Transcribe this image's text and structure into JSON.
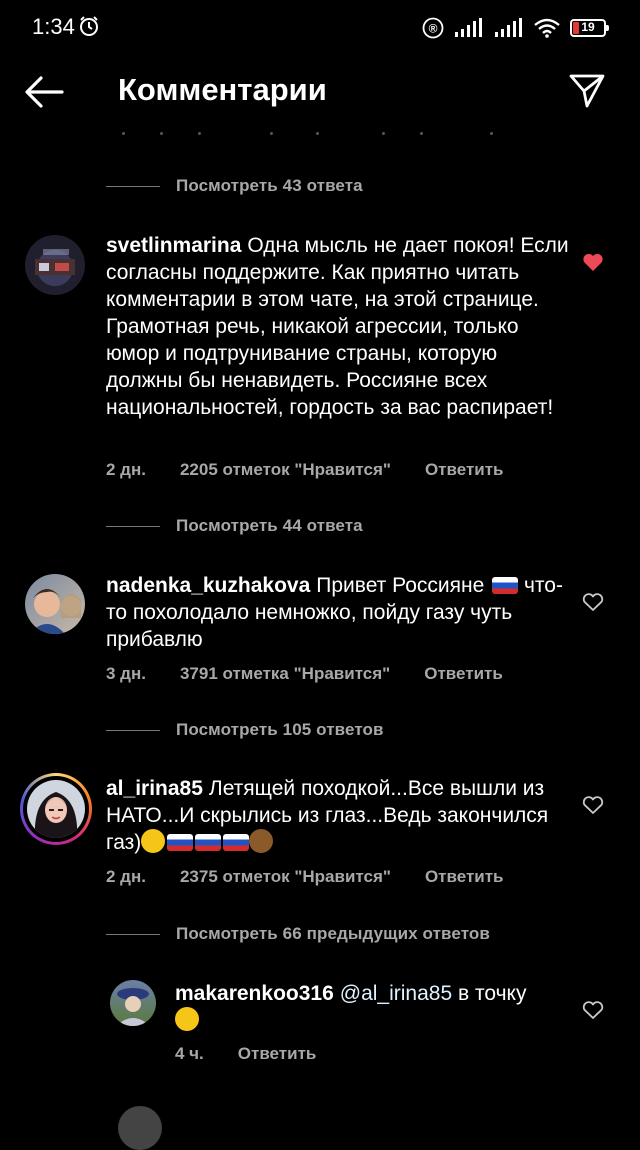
{
  "status_bar": {
    "time": "1:34",
    "registered_mark": "®",
    "battery": "19"
  },
  "header": {
    "title": "Комментарии"
  },
  "comments": [
    {
      "username": "svetlinmarina",
      "text": "Одна мысль не дает покоя! Если согласны поддержите. Как приятно читать комментарии в этом чате, на этой странице. Грамотная речь, никакой агрессии, только юмор и подтрунивание страны, которую должны бы ненавидеть. Россияне всех национальностей, гордость за вас распирает!",
      "time": "2 дн.",
      "likes": "2205 отметок \"Нравится\"",
      "reply": "Ответить",
      "liked": true,
      "view_replies": "Посмотреть 44 ответа"
    },
    {
      "username": "nadenka_kuzhakova",
      "text": "Привет Россияне",
      "text2": "что-то похолодало немножко, пойду газу чуть прибавлю",
      "time": "3 дн.",
      "likes": "3791 отметка \"Нравится\"",
      "reply": "Ответить",
      "liked": false,
      "view_replies": "Посмотреть 105 ответов"
    },
    {
      "username": "al_irina85",
      "text": "Летящей походкой...Все вышли из НАТО...И скрылись из глаз...Ведь закончился газ)",
      "time": "2 дн.",
      "likes": "2375 отметок \"Нравится\"",
      "reply": "Ответить",
      "liked": false,
      "view_replies": "Посмотреть 66 предыдущих ответов"
    }
  ],
  "reply": {
    "username": "makarenkoo316",
    "mention": "@al_irina85",
    "text": "в точку",
    "time": "4 ч.",
    "reply": "Ответить"
  },
  "top_view_replies": "Посмотреть 43 ответа",
  "colors": {
    "background": "#000000",
    "secondary_text": "#a8a8a8",
    "heart_liked": "#ed4956",
    "story_ring": "#e1306c"
  }
}
